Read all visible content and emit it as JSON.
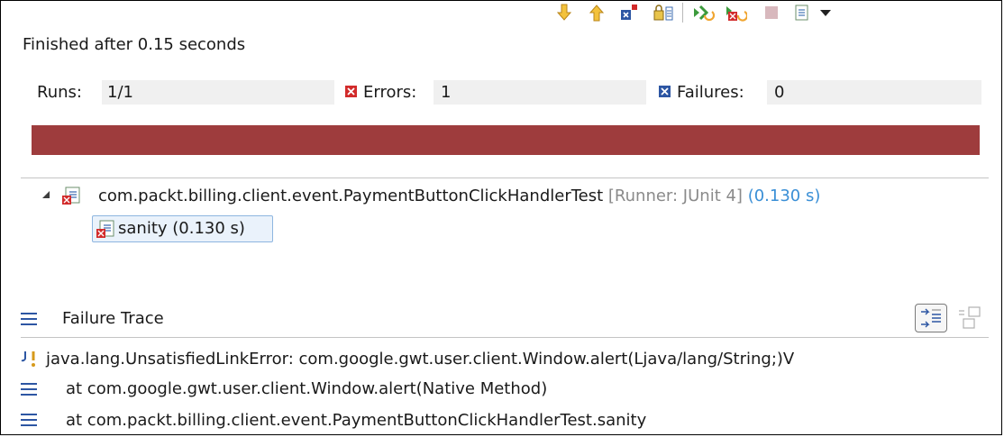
{
  "status": {
    "finished_text": "Finished after 0.15 seconds"
  },
  "counters": {
    "runs_label": "Runs:",
    "runs_value": "1/1",
    "errors_label": "Errors:",
    "errors_value": "1",
    "failures_label": "Failures:",
    "failures_value": "0"
  },
  "progress": {
    "state": "error",
    "fraction": 1.0,
    "color": "#9e3c3d"
  },
  "tree": {
    "suite_name": "com.packt.billing.client.event.PaymentButtonClickHandlerTest",
    "suite_runner": "[Runner: JUnit 4]",
    "suite_time": "(0.130 s)",
    "test_label": "sanity (0.130 s)"
  },
  "failure_trace": {
    "title": "Failure Trace",
    "lines": [
      "java.lang.UnsatisfiedLinkError: com.google.gwt.user.client.Window.alert(Ljava/lang/String;)V",
      "at com.google.gwt.user.client.Window.alert(Native Method)",
      "at com.packt.billing.client.event.PaymentButtonClickHandlerTest.sanity"
    ]
  },
  "colors": {
    "accent_link": "#3a8fd6",
    "runner_gray": "#8a8a8a",
    "error_red": "#d22b2b",
    "failure_blue": "#2d56a3"
  },
  "icons": {
    "toolbar": [
      "next-failure-icon",
      "previous-failure-icon",
      "show-failures-only-icon",
      "scroll-lock-icon",
      "rerun-icon",
      "rerun-failed-first-icon",
      "stop-icon",
      "history-icon",
      "view-menu-icon"
    ]
  }
}
